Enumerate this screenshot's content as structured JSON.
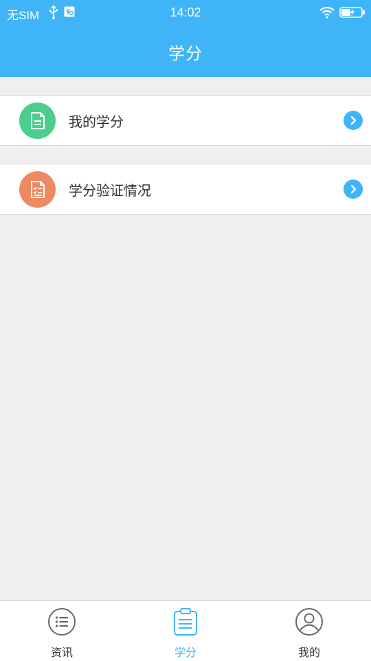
{
  "status_bar": {
    "carrier": "无SIM",
    "time": "14:02"
  },
  "header": {
    "title": "学分"
  },
  "menu": {
    "items": [
      {
        "label": "我的学分",
        "icon": "document-icon",
        "color": "#4bcd8e"
      },
      {
        "label": "学分验证情况",
        "icon": "checklist-icon",
        "color": "#ee8a62"
      }
    ]
  },
  "tabbar": {
    "tabs": [
      {
        "label": "资讯",
        "icon": "list-icon",
        "active": false
      },
      {
        "label": "学分",
        "icon": "clipboard-icon",
        "active": true
      },
      {
        "label": "我的",
        "icon": "user-icon",
        "active": false
      }
    ]
  },
  "colors": {
    "accent": "#3fb4f6",
    "background": "#efefef"
  }
}
